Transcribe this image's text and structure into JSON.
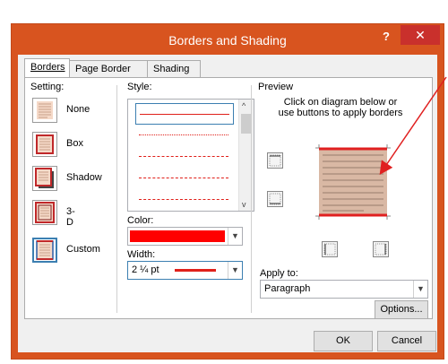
{
  "dialog": {
    "title": "Borders and Shading",
    "help_label": "?",
    "close_label": "✕"
  },
  "tabs": [
    {
      "label": "Borders",
      "active": true
    },
    {
      "label": "Page Border",
      "active": false
    },
    {
      "label": "Shading",
      "active": false
    }
  ],
  "setting": {
    "heading": "Setting:",
    "options": [
      {
        "label": "None",
        "selected": false
      },
      {
        "label": "Box",
        "selected": false
      },
      {
        "label": "Shadow",
        "selected": false
      },
      {
        "label": "3-D",
        "selected": false
      },
      {
        "label": "Custom",
        "selected": true
      }
    ]
  },
  "style": {
    "heading": "Style:",
    "line_color": "#e0201a"
  },
  "color": {
    "heading": "Color:",
    "value_color": "#ff0000"
  },
  "width": {
    "heading": "Width:",
    "value": "2 ¼ pt"
  },
  "preview": {
    "heading": "Preview",
    "instruction_line1": "Click on diagram below or",
    "instruction_line2": "use buttons to apply borders",
    "shading_color": "#d9b8a4",
    "border_color": "#e02020"
  },
  "apply_to": {
    "heading": "Apply to:",
    "value": "Paragraph"
  },
  "buttons": {
    "options": "Options...",
    "ok": "OK",
    "cancel": "Cancel"
  },
  "annotation": {
    "arrow_color": "#e02020"
  }
}
